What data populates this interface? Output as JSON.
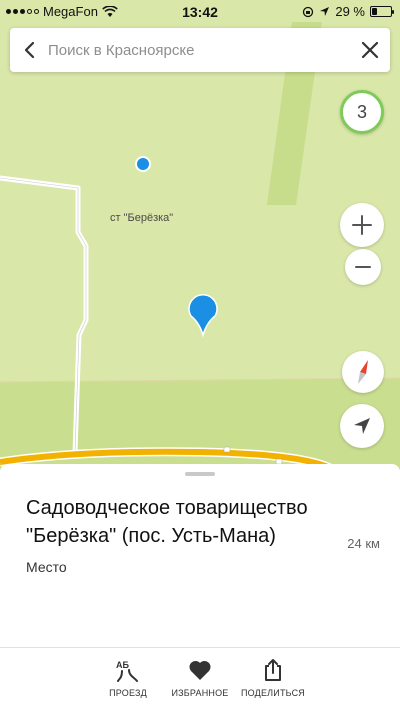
{
  "status_bar": {
    "carrier": "MegaFon",
    "time": "13:42",
    "battery": "29 %",
    "battery_level": 0.29
  },
  "search": {
    "placeholder": "Поиск в Красноярске"
  },
  "map": {
    "place_label": "ст \"Берёзка\"",
    "traffic_level": "3",
    "colors": {
      "land": "#d9e7a9",
      "green_patch": "#c7dd8b",
      "road": "#f3b100",
      "pin": "#1a8fe3"
    }
  },
  "place": {
    "title": "Садоводческое товарищество \"Берёзка\" (пос. Усть-Мана)",
    "distance": "24 км",
    "category": "Место"
  },
  "actions": {
    "route_label": "ПРОЕЗД",
    "route_icon_text": "АБ",
    "favorites_label": "ИЗБРАННОЕ",
    "share_label": "ПОДЕЛИТЬСЯ"
  },
  "icons": {
    "back": "back-arrow-icon",
    "close": "close-icon",
    "zoom_in": "plus-icon",
    "zoom_out": "minus-icon",
    "compass": "compass-icon",
    "locate": "location-arrow-icon",
    "favorites": "heart-icon",
    "share": "share-icon"
  }
}
